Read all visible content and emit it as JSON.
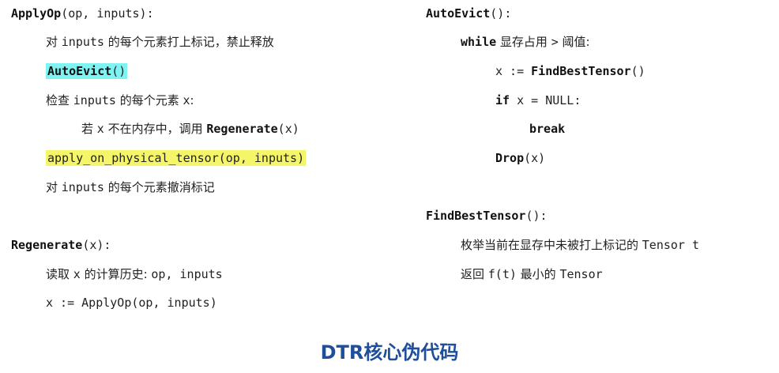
{
  "left": {
    "applyop": {
      "fn": "ApplyOp",
      "sig": "(op, inputs):",
      "l1_a": "对 ",
      "l1_b": "inputs",
      "l1_c": " 的每个元素打上标记，禁止释放",
      "l2_fn": "AutoEvict",
      "l2_paren": "()",
      "l3_a": "检查 ",
      "l3_b": "inputs",
      "l3_c": " 的每个元素 ",
      "l3_d": "x",
      "l3_e": ":",
      "l4_a": "若 ",
      "l4_b": "x",
      "l4_c": " 不在内存中，调用 ",
      "l4_fn": "Regenerate",
      "l4_args": "(x)",
      "l5": "apply_on_physical_tensor(op, inputs)",
      "l6_a": "对 ",
      "l6_b": "inputs",
      "l6_c": " 的每个元素撤消标记"
    },
    "regenerate": {
      "fn": "Regenerate",
      "sig": "(x):",
      "l1_a": "读取 ",
      "l1_b": "x",
      "l1_c": " 的计算历史: ",
      "l1_d": "op, inputs",
      "l2": "x := ApplyOp(op, inputs)"
    }
  },
  "right": {
    "autoevict": {
      "fn": "AutoEvict",
      "sig": "():",
      "l1_kw": "while",
      "l1_a": " 显存占用 ",
      "l1_b": ">",
      "l1_c": " 阈值:",
      "l2_a": "x := ",
      "l2_fn": "FindBestTensor",
      "l2_paren": "()",
      "l3_kw": "if",
      "l3_a": " x = NULL:",
      "l4_kw": "break",
      "l5_fn": "Drop",
      "l5_args": "(x)"
    },
    "findbest": {
      "fn": "FindBestTensor",
      "sig": "():",
      "l1_a": "枚举当前在显存中未被打上标记的 ",
      "l1_b": "Tensor t",
      "l2_a": "返回 ",
      "l2_b": "f(t)",
      "l2_c": " 最小的 ",
      "l2_d": "Tensor"
    }
  },
  "title": "DTR核心伪代码"
}
